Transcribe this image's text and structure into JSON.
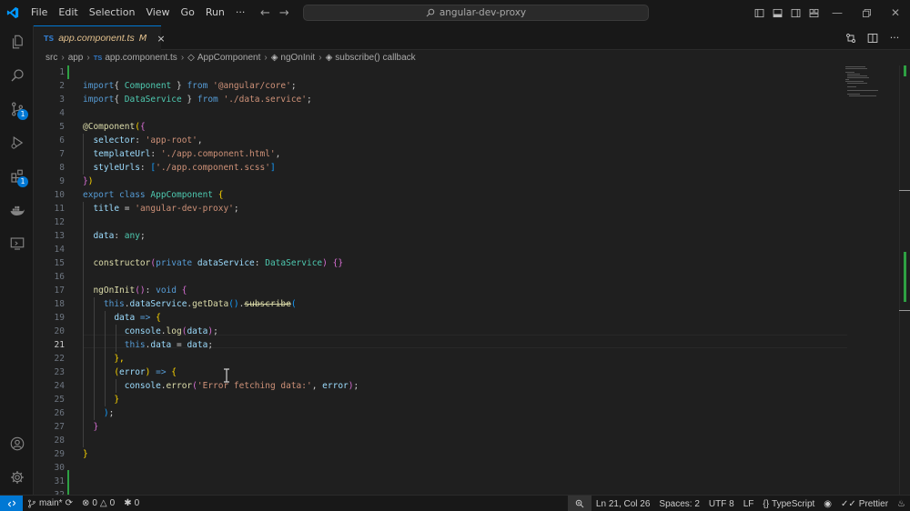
{
  "window": {
    "menu": [
      "File",
      "Edit",
      "Selection",
      "View",
      "Go",
      "Run",
      "···"
    ],
    "search_text": "angular-dev-proxy",
    "icons": [
      "vscode-logo",
      "back-arrow",
      "forward-arrow",
      "search-icon",
      "toggle-primary-sidebar",
      "toggle-panel",
      "toggle-secondary-sidebar",
      "customize-layout",
      "minimize",
      "restore",
      "close"
    ]
  },
  "activity_bar": {
    "items": [
      {
        "name": "explorer",
        "icon": "files-icon",
        "badge": ""
      },
      {
        "name": "search",
        "icon": "search-icon",
        "badge": ""
      },
      {
        "name": "source-control",
        "icon": "source-control-icon",
        "badge": "1"
      },
      {
        "name": "run-debug",
        "icon": "run-debug-icon",
        "badge": ""
      },
      {
        "name": "extensions",
        "icon": "extensions-icon",
        "badge": "1"
      },
      {
        "name": "docker",
        "icon": "docker-icon",
        "badge": ""
      },
      {
        "name": "remote-explorer",
        "icon": "remote-explorer-icon",
        "badge": ""
      }
    ],
    "bottom": [
      {
        "name": "accounts",
        "icon": "account-icon"
      },
      {
        "name": "manage",
        "icon": "gear-icon"
      }
    ]
  },
  "tab": {
    "lang_badge": "TS",
    "label": "app.component.ts",
    "modified": "M",
    "close": "×"
  },
  "breadcrumbs": {
    "parts": [
      "src",
      "app"
    ],
    "file_badge": "TS",
    "file": "app.component.ts",
    "class": "AppComponent",
    "method": "ngOnInit",
    "callback": "subscribe() callback"
  },
  "editor": {
    "active_line": 21,
    "lines": [
      [],
      [
        [
          "kw",
          "import"
        ],
        [
          "",
          "{ "
        ],
        [
          "ty",
          "Component"
        ],
        [
          "",
          " } "
        ],
        [
          "kw",
          "from"
        ],
        [
          "st",
          " '@angular/core'"
        ],
        [
          "",
          ";"
        ]
      ],
      [
        [
          "kw",
          "import"
        ],
        [
          "",
          "{ "
        ],
        [
          "ty",
          "DataService"
        ],
        [
          "",
          " } "
        ],
        [
          "kw",
          "from"
        ],
        [
          "st",
          " './data.service'"
        ],
        [
          "",
          ";"
        ]
      ],
      [],
      [
        [
          "dec",
          "@Component"
        ],
        [
          "br1",
          "("
        ],
        [
          "br2",
          "{"
        ]
      ],
      [
        [
          "pr",
          "  selector"
        ],
        [
          "",
          ": "
        ],
        [
          "st",
          "'app-root'"
        ],
        [
          "",
          ","
        ]
      ],
      [
        [
          "pr",
          "  templateUrl"
        ],
        [
          "",
          ": "
        ],
        [
          "st",
          "'./app.component.html'"
        ],
        [
          "",
          ","
        ]
      ],
      [
        [
          "pr",
          "  styleUrls"
        ],
        [
          "",
          ": "
        ],
        [
          "br3",
          "["
        ],
        [
          "st",
          "'./app.component.scss'"
        ],
        [
          "br3",
          "]"
        ]
      ],
      [
        [
          "br2",
          "}"
        ],
        [
          "br1",
          ")"
        ]
      ],
      [
        [
          "kw",
          "export"
        ],
        [
          "kw",
          " class "
        ],
        [
          "ty",
          "AppComponent"
        ],
        [
          "br1",
          " {"
        ]
      ],
      [
        [
          "pr",
          "  title"
        ],
        [
          "",
          " = "
        ],
        [
          "st",
          "'angular-dev-proxy'"
        ],
        [
          "",
          ";"
        ]
      ],
      [],
      [
        [
          "pr",
          "  data"
        ],
        [
          "",
          ": "
        ],
        [
          "ty",
          "any"
        ],
        [
          "",
          ";"
        ]
      ],
      [],
      [
        [
          "fn",
          "  constructor"
        ],
        [
          "br2",
          "("
        ],
        [
          "kw",
          "private "
        ],
        [
          "pr",
          "dataService"
        ],
        [
          "",
          ": "
        ],
        [
          "ty",
          "DataService"
        ],
        [
          "br2",
          ")"
        ],
        [
          "br2",
          " {}"
        ]
      ],
      [],
      [
        [
          "fn",
          "  ngOnInit"
        ],
        [
          "br2",
          "()"
        ],
        [
          "",
          ": "
        ],
        [
          "kw",
          "void"
        ],
        [
          "br2",
          " {"
        ]
      ],
      [
        [
          "kw",
          "    this"
        ],
        [
          "",
          "."
        ],
        [
          "pr",
          "dataService"
        ],
        [
          "",
          "."
        ],
        [
          "fn",
          "getData"
        ],
        [
          "br3",
          "()"
        ],
        [
          "",
          "."
        ],
        [
          "strike",
          "subscribe"
        ],
        [
          "br3",
          "("
        ]
      ],
      [
        [
          "pr",
          "      data"
        ],
        [
          "kw",
          " =>"
        ],
        [
          "br1",
          " {"
        ]
      ],
      [
        [
          "pr",
          "        console"
        ],
        [
          "",
          "."
        ],
        [
          "fn",
          "log"
        ],
        [
          "br2",
          "("
        ],
        [
          "pr",
          "data"
        ],
        [
          "br2",
          ")"
        ],
        [
          "",
          ";"
        ]
      ],
      [
        [
          "kw",
          "        this"
        ],
        [
          "",
          "."
        ],
        [
          "pr",
          "data"
        ],
        [
          "",
          " = "
        ],
        [
          "pr",
          "data"
        ],
        [
          "",
          ";"
        ]
      ],
      [
        [
          "br1",
          "      },"
        ]
      ],
      [
        [
          "br1",
          "      ("
        ],
        [
          "pr",
          "error"
        ],
        [
          "br1",
          ")"
        ],
        [
          "kw",
          " =>"
        ],
        [
          "br1",
          " {"
        ]
      ],
      [
        [
          "pr",
          "        console"
        ],
        [
          "",
          "."
        ],
        [
          "fn",
          "error"
        ],
        [
          "br2",
          "("
        ],
        [
          "st",
          "'Error fetching data:'"
        ],
        [
          "",
          ", "
        ],
        [
          "pr",
          "error"
        ],
        [
          "br2",
          ")"
        ],
        [
          "",
          ";"
        ]
      ],
      [
        [
          "br1",
          "      }"
        ]
      ],
      [
        [
          "br3",
          "    )"
        ],
        [
          "",
          ";"
        ]
      ],
      [
        [
          "br2",
          "  }"
        ]
      ],
      [],
      [
        [
          "br1",
          "}"
        ]
      ],
      [],
      [],
      []
    ]
  },
  "status": {
    "branch": "main*",
    "errors": "0",
    "warnings": "0",
    "ports": "0",
    "position": "Ln 21, Col 26",
    "spaces": "Spaces: 2",
    "encoding": "UTF 8",
    "eol": "LF",
    "language": "TypeScript",
    "formatter": "Prettier"
  }
}
